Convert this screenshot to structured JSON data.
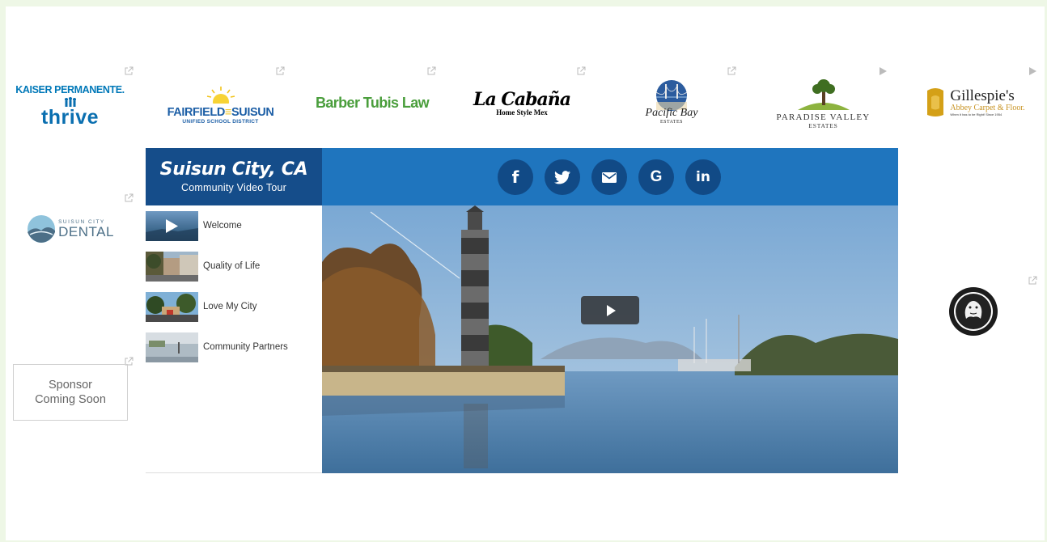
{
  "sponsors": {
    "kaiser": {
      "line1": "KAISER PERMANENTE.",
      "line2": "thrive"
    },
    "fairfield": {
      "line1": "FAIRFIELD",
      "line1b": "SUISUN",
      "line2": "UNIFIED SCHOOL DISTRICT"
    },
    "barber": {
      "name": "Barber Tubis Law"
    },
    "cabana": {
      "name": "La Cabaña",
      "sub": "Home Style Mex"
    },
    "pacific_bay": {
      "name": "Pacific Bay",
      "sub": "ESTATES"
    },
    "paradise_valley": {
      "name": "PARADISE VALLEY",
      "sub": "ESTATES"
    },
    "gillespie": {
      "name": "Gillespie's",
      "sub": "Abbey Carpet & Floor.",
      "tagline": "When it has to be Right! Since 1954"
    },
    "dental": {
      "top": "SUISUN CITY",
      "main": "DENTAL"
    },
    "coming_soon": {
      "line1": "Sponsor",
      "line2": "Coming Soon"
    }
  },
  "player": {
    "title": "Suisun City, CA",
    "subtitle": "Community Video Tour",
    "share": {
      "facebook": "f",
      "google": "G",
      "linkedin": "in"
    },
    "playlist": [
      {
        "label": "Welcome"
      },
      {
        "label": "Quality of Life"
      },
      {
        "label": "Love My City"
      },
      {
        "label": "Community Partners"
      }
    ]
  },
  "colors": {
    "header_dark": "#154d8a",
    "header_bar": "#1f75be",
    "share_circle": "#114a86",
    "page_bg": "#eef7e6"
  },
  "icons": {
    "external_link": "external-link-icon",
    "play": "play-icon"
  }
}
